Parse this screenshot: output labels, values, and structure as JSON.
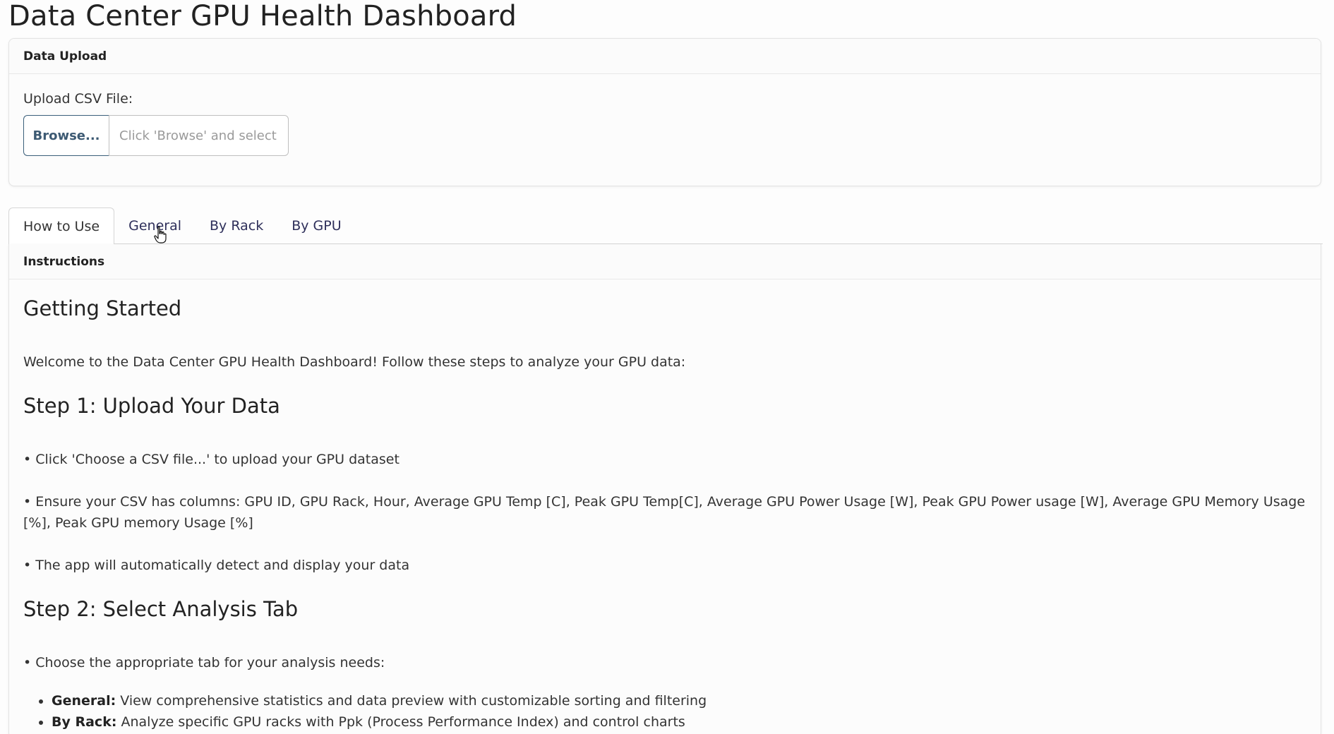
{
  "app": {
    "title": "Data Center GPU Health Dashboard"
  },
  "upload": {
    "card_title": "Data Upload",
    "label": "Upload CSV File:",
    "browse_label": "Browse...",
    "placeholder": "Click 'Browse' and select a CSV file"
  },
  "tabs": [
    {
      "label": "How to Use",
      "active": true
    },
    {
      "label": "General",
      "active": false
    },
    {
      "label": "By Rack",
      "active": false
    },
    {
      "label": "By GPU",
      "active": false
    }
  ],
  "instructions": {
    "card_title": "Instructions",
    "heading": "Getting Started",
    "welcome": "Welcome to the Data Center GPU Health Dashboard! Follow these steps to analyze your GPU data:",
    "step1": {
      "title": "Step 1: Upload Your Data",
      "items": [
        "• Click 'Choose a CSV file...' to upload your GPU dataset",
        "• Ensure your CSV has columns: GPU ID, GPU Rack, Hour, Average GPU Temp [C], Peak GPU Temp[C], Average GPU Power Usage [W], Peak GPU Power usage [W], Average GPU Memory Usage [%], Peak GPU memory Usage [%]",
        "• The app will automatically detect and display your data"
      ]
    },
    "step2": {
      "title": "Step 2: Select Analysis Tab",
      "intro": "• Choose the appropriate tab for your analysis needs:",
      "bullets": [
        {
          "term": "General:",
          "text": " View comprehensive statistics and data preview with customizable sorting and filtering"
        },
        {
          "term": "By Rack:",
          "text": " Analyze specific GPU racks with Ppk (Process Performance Index) and control charts"
        }
      ]
    }
  }
}
